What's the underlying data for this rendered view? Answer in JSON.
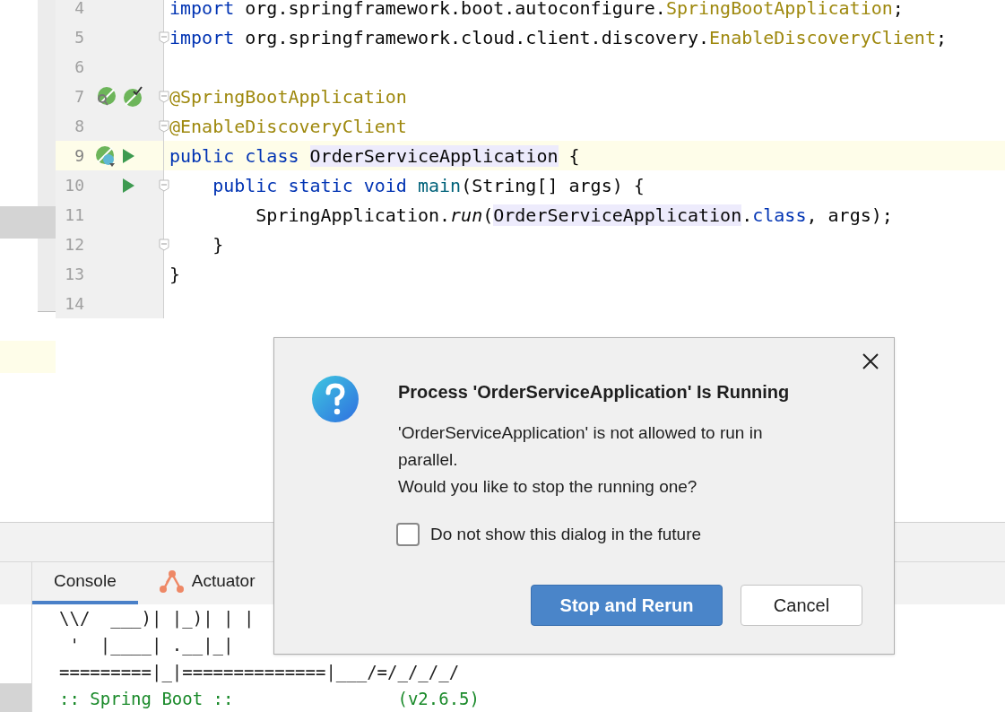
{
  "editor": {
    "lines": [
      {
        "number": "4",
        "kind": "plain",
        "current": false,
        "fold": false,
        "tokens": [
          {
            "kind": "keyword",
            "text": "import"
          },
          {
            "kind": "plain",
            "text": " org.springframework.boot.autoconfigure."
          },
          {
            "kind": "annotation",
            "text": "SpringBootApplication"
          },
          {
            "kind": "plain",
            "text": ";"
          }
        ]
      },
      {
        "number": "5",
        "kind": "plain",
        "current": false,
        "fold": true,
        "tokens": [
          {
            "kind": "keyword",
            "text": "import"
          },
          {
            "kind": "plain",
            "text": " org.springframework.cloud.client.discovery."
          },
          {
            "kind": "annotation",
            "text": "EnableDiscoveryClient"
          },
          {
            "kind": "plain",
            "text": ";"
          }
        ]
      },
      {
        "number": "6",
        "kind": "plain",
        "current": false,
        "fold": false
      },
      {
        "number": "7",
        "kind": "spring-config",
        "current": false,
        "fold": true,
        "tokens": [
          {
            "kind": "annotation",
            "text": "@SpringBootApplication"
          }
        ]
      },
      {
        "number": "8",
        "kind": "plain",
        "current": false,
        "fold": true,
        "tokens": [
          {
            "kind": "annotation",
            "text": "@EnableDiscoveryClient"
          }
        ]
      },
      {
        "number": "9",
        "kind": "spring-class",
        "current": true,
        "fold": false,
        "tokens": [
          {
            "kind": "keyword",
            "text": "public class "
          },
          {
            "kind": "highlight",
            "text": "OrderServiceApplication"
          },
          {
            "kind": "plain",
            "text": " {"
          }
        ]
      },
      {
        "number": "10",
        "kind": "main-method",
        "current": false,
        "fold": true,
        "tokens": [
          {
            "kind": "keyword",
            "text": "    public static void "
          },
          {
            "kind": "method",
            "text": "main"
          },
          {
            "kind": "plain",
            "text": "(String[] args) {"
          }
        ]
      },
      {
        "number": "11",
        "kind": "plain",
        "current": false,
        "fold": false,
        "tokens": [
          {
            "kind": "plain",
            "text": "        SpringApplication."
          },
          {
            "kind": "italic",
            "text": "run"
          },
          {
            "kind": "plain",
            "text": "("
          },
          {
            "kind": "highlight",
            "text": "OrderServiceApplication"
          },
          {
            "kind": "plain",
            "text": "."
          },
          {
            "kind": "keyword",
            "text": "class"
          },
          {
            "kind": "plain",
            "text": ", args);"
          }
        ]
      },
      {
        "number": "12",
        "kind": "plain",
        "current": false,
        "fold": true,
        "tokens": [
          {
            "kind": "plain",
            "text": "    }"
          }
        ]
      },
      {
        "number": "13",
        "kind": "plain",
        "current": false,
        "fold": false,
        "tokens": [
          {
            "kind": "plain",
            "text": "}"
          }
        ]
      },
      {
        "number": "14",
        "kind": "plain",
        "current": false,
        "fold": false
      }
    ]
  },
  "tool_window": {
    "tabs": [
      {
        "label": "Console",
        "selected": true
      },
      {
        "label": "Actuator",
        "selected": false
      }
    ],
    "console_lines": [
      {
        "kind": "plain",
        "text": "\\\\/  ___)| |_)| | |"
      },
      {
        "kind": "plain",
        "text": " '  |____| .__|_|"
      },
      {
        "kind": "plain",
        "text": "=========|_|==============|___/=/_/_/_/"
      },
      {
        "kind": "green",
        "text": ":: Spring Boot ::                (v2.6.5)"
      }
    ]
  },
  "dialog": {
    "title": "Process 'OrderServiceApplication' Is Running",
    "message_lines": [
      "'OrderServiceApplication' is not allowed to run in",
      "parallel.",
      "Would you like to stop the running one?"
    ],
    "checkbox": {
      "label": "Do not show this dialog in the future",
      "checked": false
    },
    "buttons": [
      {
        "label": "Stop and Rerun",
        "primary": true
      },
      {
        "label": "Cancel",
        "primary": false
      }
    ]
  }
}
